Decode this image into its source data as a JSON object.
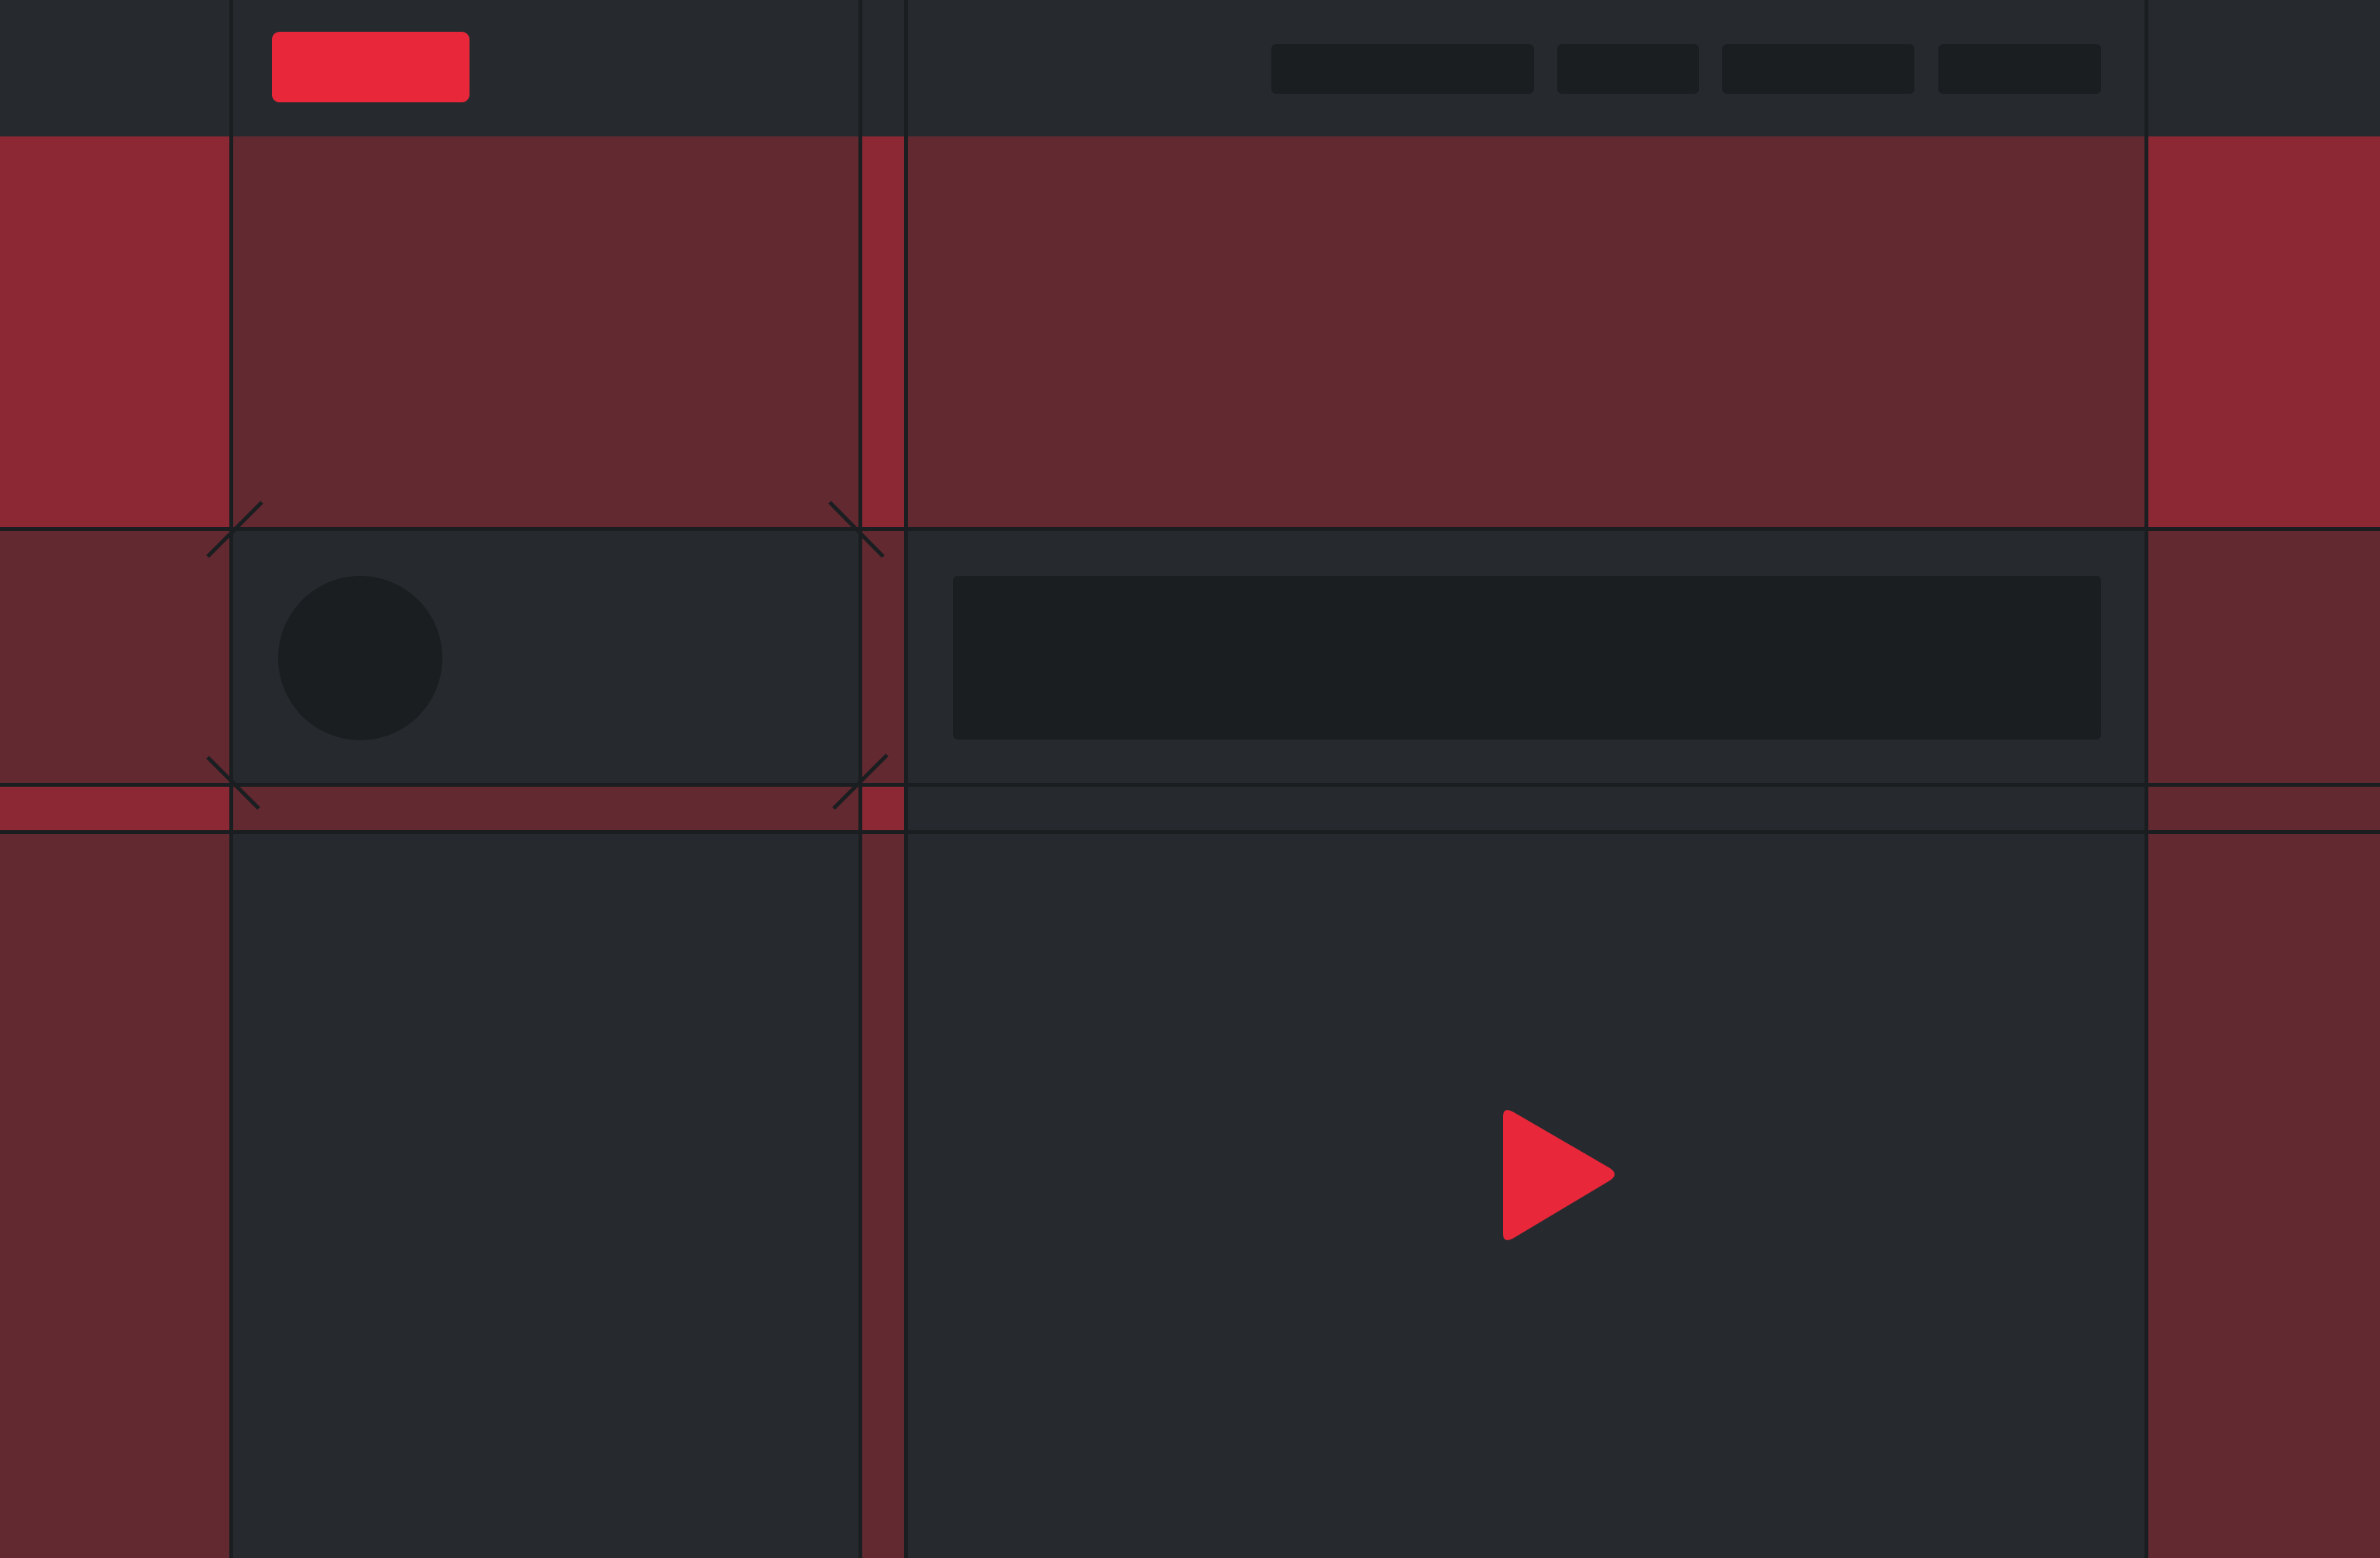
{
  "header": {
    "logo": {
      "color": "#e8283a"
    },
    "nav": [
      {
        "name": "nav-item-1"
      },
      {
        "name": "nav-item-2"
      },
      {
        "name": "nav-item-3"
      },
      {
        "name": "nav-item-4"
      }
    ]
  },
  "colors": {
    "background": "#262a2e",
    "accent": "#e8283a",
    "guide_strong": "#8b2834",
    "guide_soft": "#622931",
    "placeholder": "#1a1e20",
    "grid_line": "#1a1e20"
  },
  "icons": {
    "play": "play-icon",
    "avatar": "avatar-placeholder",
    "corner_marks": "crosshair-mark"
  }
}
